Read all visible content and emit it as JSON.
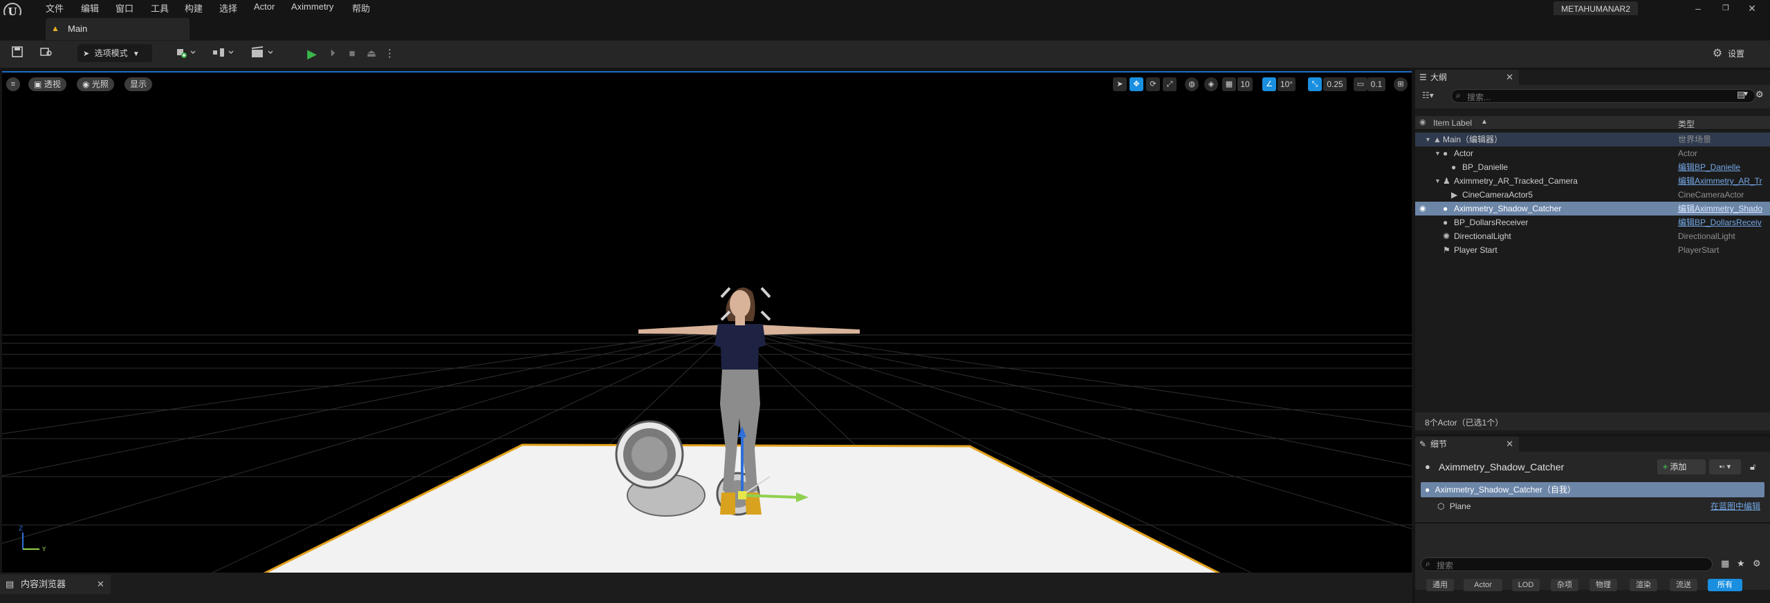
{
  "menu": [
    "文件",
    "编辑",
    "窗口",
    "工具",
    "构建",
    "选择",
    "Actor",
    "Aximmetry",
    "帮助"
  ],
  "project_name": "METAHUMANAR2",
  "level_tab": "Main",
  "toolbar": {
    "mode_label": "选项模式",
    "settings_label": "设置"
  },
  "viewport": {
    "perspective_label": "透视",
    "lit_label": "光照",
    "show_label": "显示",
    "grid_snap": "10",
    "rotation_snap": "10°",
    "scale_snap": "0.25",
    "camera_speed": "0.1"
  },
  "outliner": {
    "tab_label": "大纲",
    "search_placeholder": "搜索...",
    "col_label": "Item Label",
    "col_type": "类型",
    "rows": [
      {
        "label": "Main（编辑器）",
        "type": "世界场景",
        "link": false
      },
      {
        "label": "Actor",
        "type": "Actor",
        "link": false
      },
      {
        "label": "BP_Danielle",
        "type": "编辑BP_Danielle",
        "link": true
      },
      {
        "label": "Aximmetry_AR_Tracked_Camera",
        "type": "编辑Aximmetry_AR_Tr",
        "link": true
      },
      {
        "label": "CineCameraActor5",
        "type": "CineCameraActor",
        "link": false
      },
      {
        "label": "Aximmetry_Shadow_Catcher",
        "type": "编辑Aximmetry_Shado",
        "link": true
      },
      {
        "label": "BP_DollarsReceiver",
        "type": "编辑BP_DollarsReceiv",
        "link": true
      },
      {
        "label": "DirectionalLight",
        "type": "DirectionalLight",
        "link": false
      },
      {
        "label": "Player Start",
        "type": "PlayerStart",
        "link": false
      }
    ],
    "status": "8个Actor（已选1个）"
  },
  "details": {
    "tab_label": "细节",
    "actor_name": "Aximmetry_Shadow_Catcher",
    "add_label": "添加",
    "self_row": "Aximmetry_Shadow_Catcher（自我）",
    "component": "Plane",
    "component_link": "在蓝图中编辑",
    "search_placeholder": "搜索",
    "filters": [
      "通用",
      "Actor",
      "LOD",
      "杂项",
      "物理",
      "渲染",
      "流送",
      "所有"
    ]
  },
  "content_browser": {
    "tab_label": "内容浏览器"
  },
  "colors": {
    "accent": "#1a8fe0",
    "selection": "#6c86a8",
    "selected_text": "#ffffff",
    "link": "#74a8e6",
    "floor": "#f2f2f2",
    "floor_edge": "#e2a11c"
  }
}
